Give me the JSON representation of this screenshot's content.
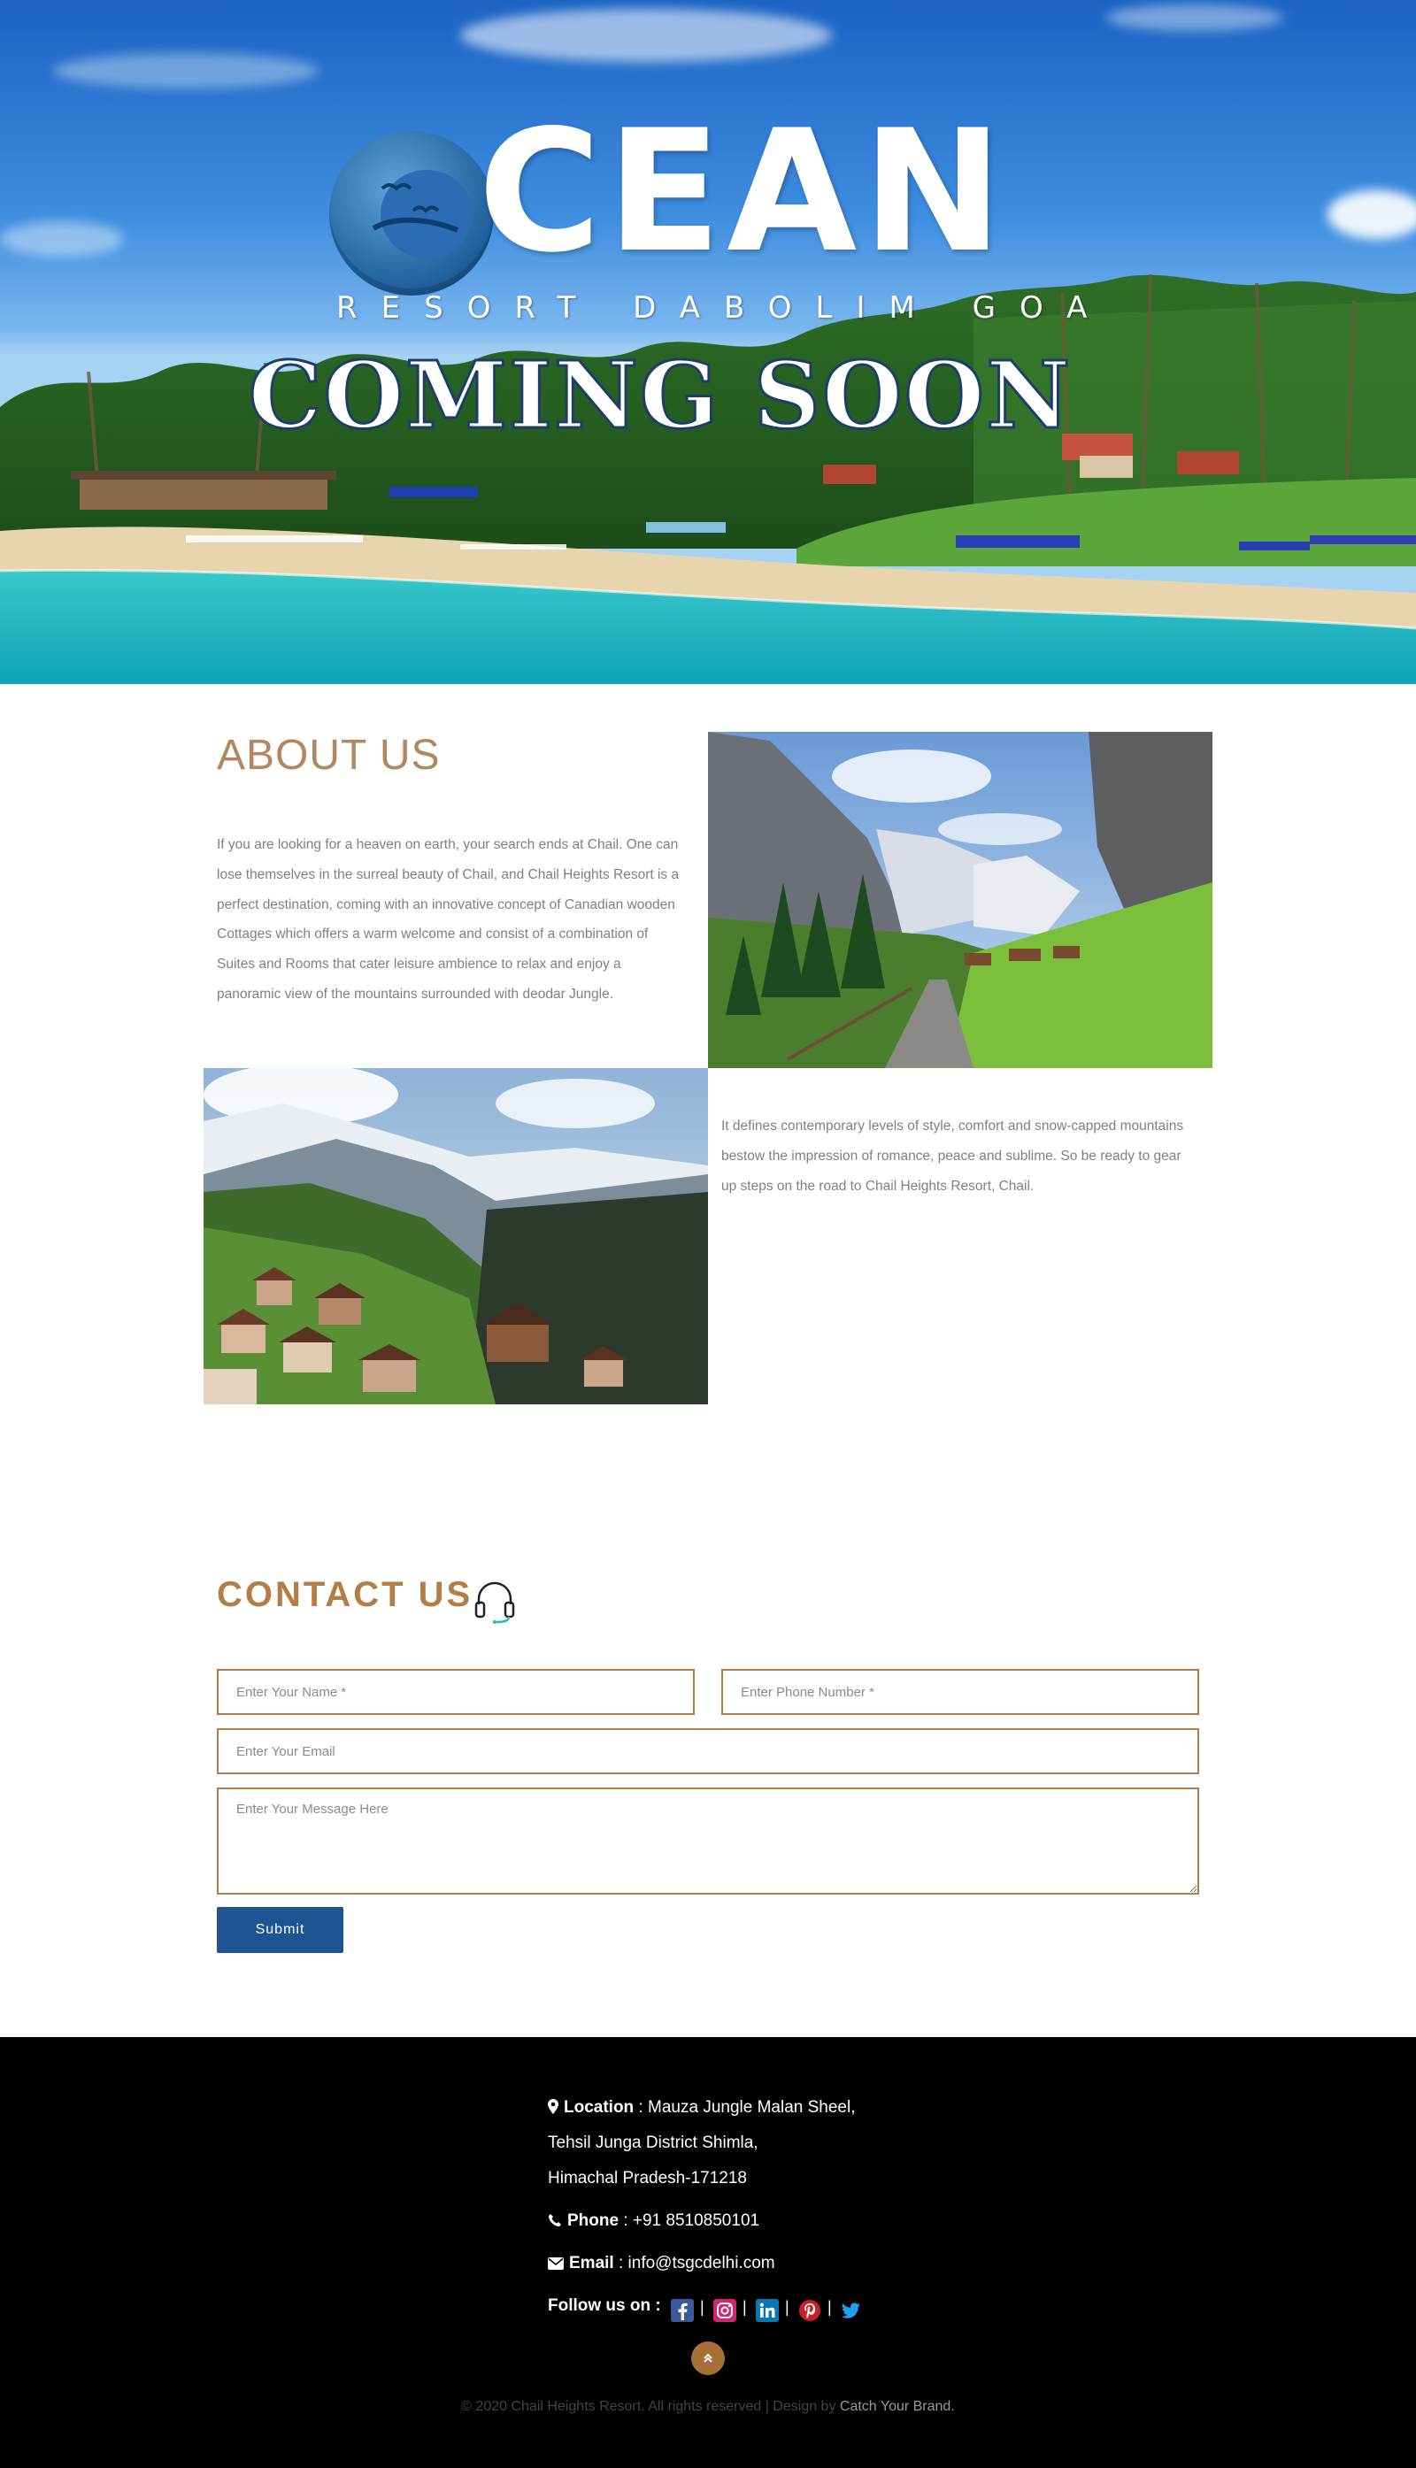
{
  "hero": {
    "logo_main": "CEAN",
    "logo_sub": "RESORT DABOLIM GOA",
    "headline": "COMING SOON"
  },
  "about": {
    "title": "ABOUT US",
    "paragraph_1": "If you are looking for a heaven on earth, your search ends at Chail. One can lose themselves in the surreal beauty of Chail, and Chail Heights Resort is a perfect destination, coming with an innovative concept of Canadian wooden Cottages which offers a warm welcome and consist of a combination of Suites and Rooms that cater leisure ambience to relax and enjoy a panoramic view of the mountains surrounded with deodar Jungle.",
    "paragraph_2": "It defines contemporary levels of style, comfort and snow-capped mountains bestow the impression of romance, peace and sublime. So be ready to gear up steps on the road to Chail Heights Resort, Chail."
  },
  "contact": {
    "title": "CONTACT US",
    "icon": "headset-icon",
    "name_placeholder": "Enter Your Name *",
    "phone_placeholder": "Enter Phone Number *",
    "email_placeholder": "Enter Your Email",
    "message_placeholder": "Enter Your Message Here",
    "submit_label": "Submit"
  },
  "footer": {
    "location_label": "Location",
    "location_line1": " : Mauza Jungle Malan Sheel,",
    "location_line2": "Tehsil Junga District Shimla,",
    "location_line3": "Himachal Pradesh-171218",
    "phone_label": "Phone",
    "phone_value": " : +91 8510850101",
    "email_label": "Email",
    "email_value": " : info@tsgcdelhi.com",
    "follow_label": "Follow us on :",
    "separator": "|",
    "social": [
      "facebook-icon",
      "instagram-icon",
      "linkedin-icon",
      "pinterest-icon",
      "twitter-icon"
    ],
    "copyright_text": "© 2020 Chail Heights Resort. All rights reserved | Design by ",
    "copyright_brand": "Catch Your Brand."
  },
  "colors": {
    "accent_brown": "#b47d45",
    "submit_blue": "#1e5494",
    "footer_bg": "#000000"
  }
}
